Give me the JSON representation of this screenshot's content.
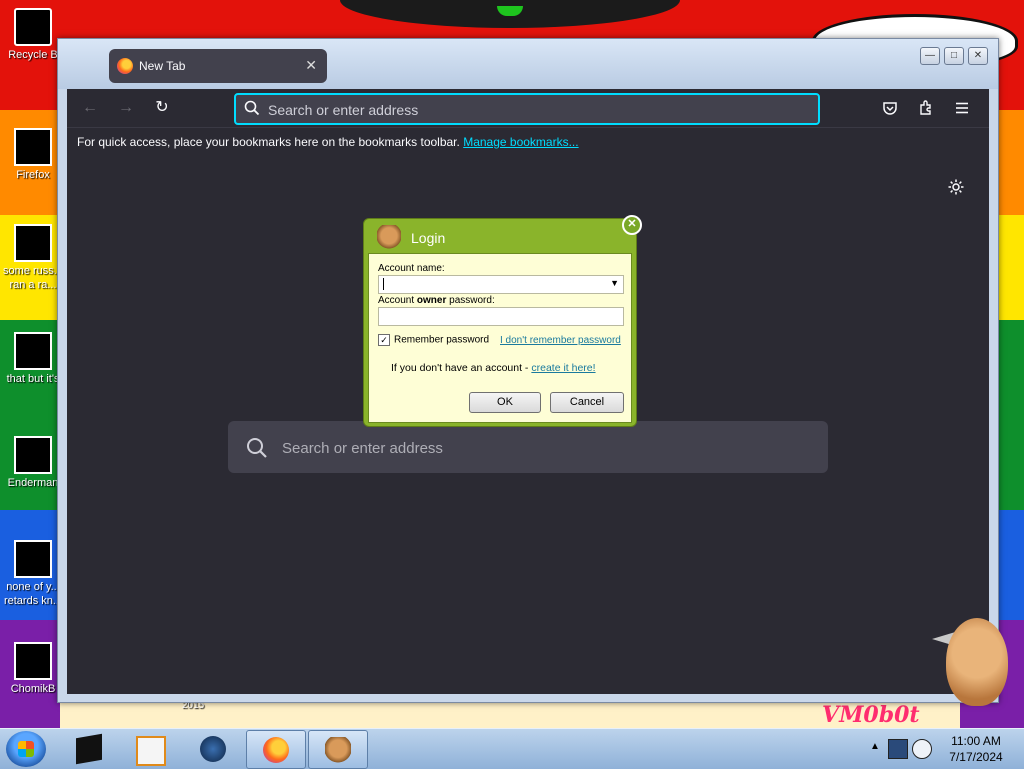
{
  "desktop": {
    "icons": [
      {
        "label": "Recycle B",
        "name": "recycle-bin"
      },
      {
        "label": "Firefox",
        "name": "firefox"
      },
      {
        "label": "some russ... ran a ra...",
        "name": "shortcut-russ"
      },
      {
        "label": "that but it's",
        "name": "shortcut-that"
      },
      {
        "label": "Enderman",
        "name": "shortcut-enderman"
      },
      {
        "label": "none of y... retards kn...",
        "name": "shortcut-none"
      },
      {
        "label": "ChomikB",
        "name": "shortcut-chomik"
      }
    ],
    "bottom_label": "2015",
    "watermark": "VM0b0t"
  },
  "browser": {
    "tab_title": "New Tab",
    "url_placeholder": "Search or enter address",
    "bookmarks_message": "For quick access, place your bookmarks here on the bookmarks toolbar.",
    "manage_bookmarks": "Manage bookmarks...",
    "content_search_placeholder": "Search or enter address"
  },
  "login_dialog": {
    "title": "Login",
    "account_name_label": "Account name:",
    "account_name_value": "",
    "password_label_prefix": "Account ",
    "password_label_bold": "owner",
    "password_label_suffix": " password:",
    "password_value": "",
    "remember_label": "Remember password",
    "remember_checked": true,
    "forgot_link": "I don't remember password",
    "no_account_text": "If you don't have an account - ",
    "create_link": "create it here!",
    "ok_label": "OK",
    "cancel_label": "Cancel"
  },
  "taskbar": {
    "clock_time": "11:00 AM",
    "clock_date": "7/17/2024"
  },
  "colors": {
    "accent_focus": "#00ddff",
    "dialog_green": "#8ab42b",
    "dialog_bg": "#fefed6"
  }
}
